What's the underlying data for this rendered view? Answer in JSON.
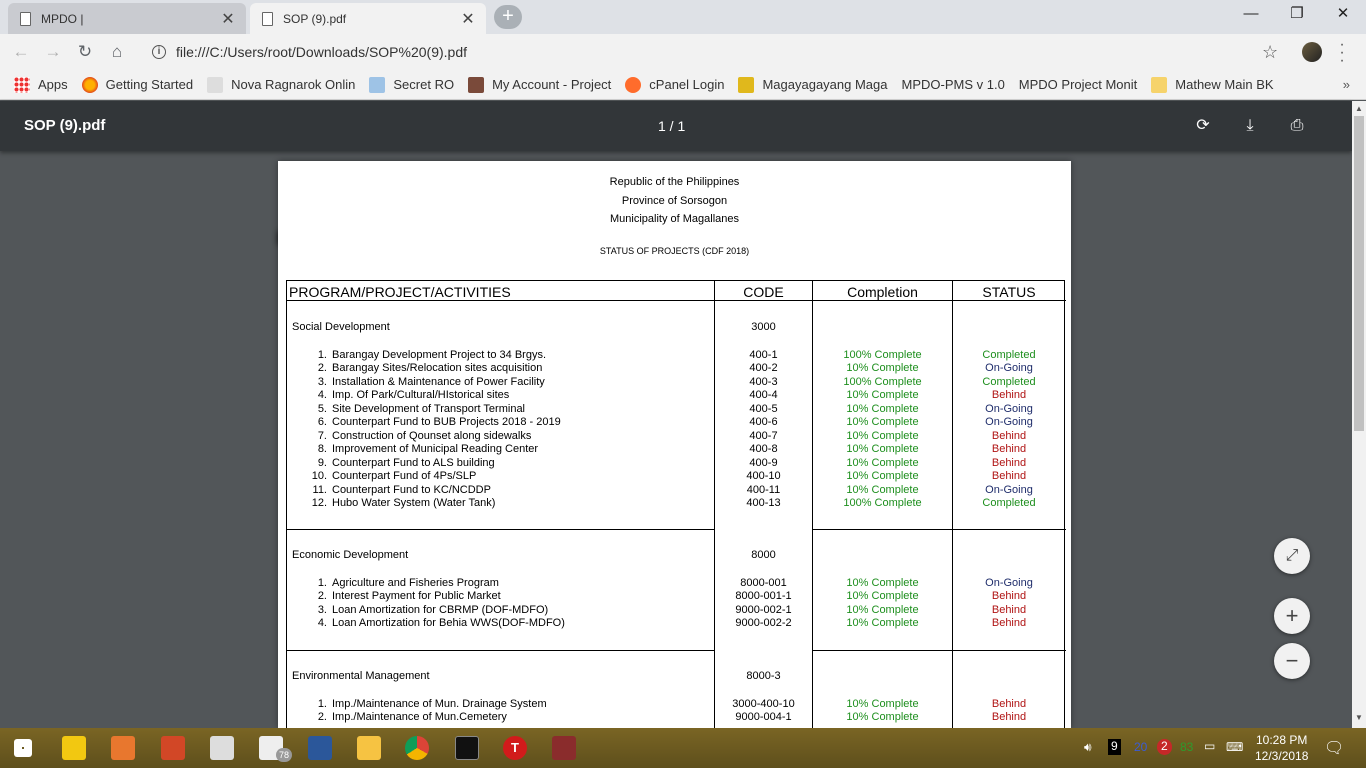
{
  "browser": {
    "tabs": [
      {
        "title": "MPDO |",
        "close": "✕"
      },
      {
        "title": "SOP (9).pdf",
        "close": "✕"
      }
    ],
    "new_tab": "+",
    "window_controls": {
      "minimize": "—",
      "restore": "❐",
      "close": "✕"
    },
    "address": "file:///C:/Users/root/Downloads/SOP%20(9).pdf",
    "bookmarks": [
      {
        "label": "Apps",
        "icon": "apps-grid-icon"
      },
      {
        "label": "Getting Started",
        "icon": "firefox-icon"
      },
      {
        "label": "Nova Ragnarok Onlin",
        "icon": "game-icon"
      },
      {
        "label": "Secret RO",
        "icon": "game-icon"
      },
      {
        "label": "My Account - Project",
        "icon": "site-icon"
      },
      {
        "label": "cPanel Login",
        "icon": "cpanel-icon"
      },
      {
        "label": "Magayagayang Maga",
        "icon": "site-icon"
      },
      {
        "label": "MPDO-PMS v 1.0",
        "icon": "page-icon"
      },
      {
        "label": "MPDO Project Monit",
        "icon": "page-icon"
      },
      {
        "label": "Mathew Main BK",
        "icon": "folder-icon"
      }
    ],
    "bookmarks_more": "»"
  },
  "viewer": {
    "title": "SOP (9).pdf",
    "page_indicator": "1 / 1"
  },
  "document": {
    "header_lines": [
      "Republic of the Philippines",
      "Province of Sorsogon",
      "Municipality of Magallanes"
    ],
    "report_title": "STATUS OF PROJECTS (CDF 2018)",
    "columns": [
      "PROGRAM/PROJECT/ACTIVITIES",
      "CODE",
      "Completion",
      "STATUS"
    ],
    "sections": [
      {
        "name": "Social Development",
        "code": "3000",
        "rows": [
          {
            "no": "1.",
            "activity": "Barangay Development Project to 34 Brgys.",
            "code": "400-1",
            "completion": "100% Complete",
            "status": "Completed"
          },
          {
            "no": "2.",
            "activity": "Barangay Sites/Relocation sites acquisition",
            "code": "400-2",
            "completion": "10% Complete",
            "status": "On-Going"
          },
          {
            "no": "3.",
            "activity": "Installation & Maintenance of Power Facility",
            "code": "400-3",
            "completion": "100% Complete",
            "status": "Completed"
          },
          {
            "no": "4.",
            "activity": "Imp. Of Park/Cultural/HIstorical sites",
            "code": "400-4",
            "completion": "10% Complete",
            "status": "Behind"
          },
          {
            "no": "5.",
            "activity": "Site Development of Transport Terminal",
            "code": "400-5",
            "completion": "10% Complete",
            "status": "On-Going"
          },
          {
            "no": "6.",
            "activity": "Counterpart Fund to BUB Projects 2018 - 2019",
            "code": "400-6",
            "completion": "10% Complete",
            "status": "On-Going"
          },
          {
            "no": "7.",
            "activity": "Construction of Qounset along sidewalks",
            "code": "400-7",
            "completion": "10% Complete",
            "status": "Behind"
          },
          {
            "no": "8.",
            "activity": "Improvement of Municipal Reading Center",
            "code": "400-8",
            "completion": "10% Complete",
            "status": "Behind"
          },
          {
            "no": "9.",
            "activity": "Counterpart Fund to ALS building",
            "code": "400-9",
            "completion": "10% Complete",
            "status": "Behind"
          },
          {
            "no": "10.",
            "activity": "Counterpart Fund of 4Ps/SLP",
            "code": "400-10",
            "completion": "10% Complete",
            "status": "Behind"
          },
          {
            "no": "11.",
            "activity": "Counterpart Fund to KC/NCDDP",
            "code": "400-11",
            "completion": "10% Complete",
            "status": "On-Going"
          },
          {
            "no": "12.",
            "activity": "Hubo Water System (Water Tank)",
            "code": "400-13",
            "completion": "100% Complete",
            "status": "Completed"
          }
        ]
      },
      {
        "name": "Economic Development",
        "code": "8000",
        "rows": [
          {
            "no": "1.",
            "activity": "Agriculture and Fisheries Program",
            "code": "8000-001",
            "completion": "10% Complete",
            "status": "On-Going"
          },
          {
            "no": "2.",
            "activity": "Interest Payment for Public Market",
            "code": "8000-001-1",
            "completion": "10% Complete",
            "status": "Behind"
          },
          {
            "no": "3.",
            "activity": "Loan Amortization for CBRMP (DOF-MDFO)",
            "code": "9000-002-1",
            "completion": "10% Complete",
            "status": "Behind"
          },
          {
            "no": "4.",
            "activity": "Loan Amortization for Behia WWS(DOF-MDFO)",
            "code": "9000-002-2",
            "completion": "10% Complete",
            "status": "Behind"
          }
        ]
      },
      {
        "name": "Environmental Management",
        "code": "8000-3",
        "rows": [
          {
            "no": "1.",
            "activity": "Imp./Maintenance of Mun. Drainage System",
            "code": "3000-400-10",
            "completion": "10% Complete",
            "status": "Behind"
          },
          {
            "no": "2.",
            "activity": "Imp./Maintenance of Mun.Cemetery",
            "code": "9000-004-1",
            "completion": "10% Complete",
            "status": "Behind"
          }
        ]
      }
    ]
  },
  "colors": {
    "complete_green": "#1e8f1e",
    "ongoing_navy": "#1f2d6b",
    "behind_red": "#b01414"
  },
  "taskbar": {
    "time": "10:28 PM",
    "date": "12/3/2018",
    "badges": {
      "mail": "78",
      "tray_a": "9",
      "tray_b": "20",
      "tray_c": "2",
      "tray_d": "83"
    }
  }
}
